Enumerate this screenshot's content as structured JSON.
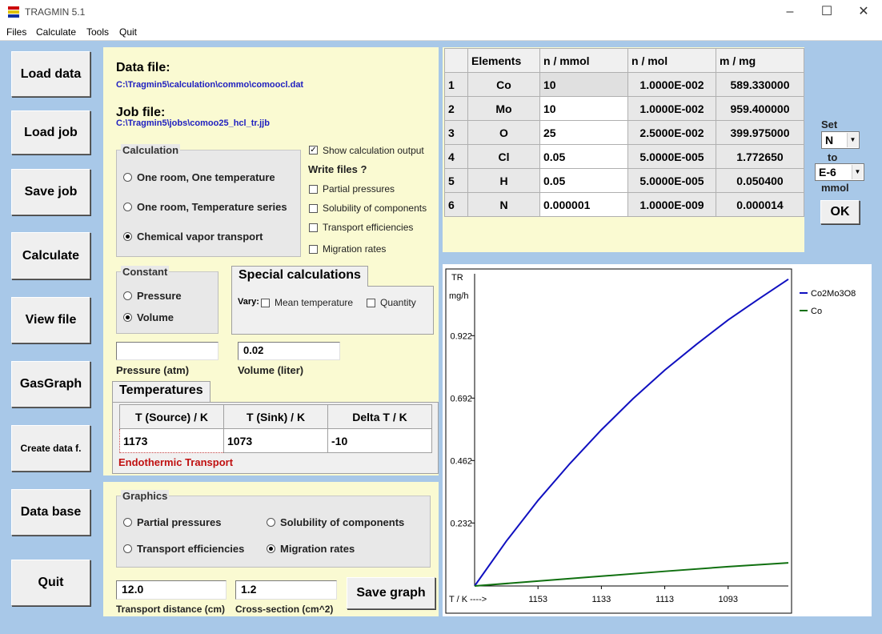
{
  "window": {
    "title": "TRAGMIN 5.1"
  },
  "menu": {
    "items": [
      "Files",
      "Calculate",
      "Tools",
      "Quit"
    ]
  },
  "sidebar": {
    "buttons": [
      "Load data",
      "Load job",
      "Save job",
      "Calculate",
      "View file",
      "GasGraph",
      "Create data f.",
      "Data base",
      "Quit"
    ]
  },
  "files": {
    "data_heading": "Data file:",
    "data_path": "C:\\Tragmin5\\calculation\\commo\\comoocl.dat",
    "job_heading": "Job file:",
    "job_path": "C:\\Tragmin5\\jobs\\comoo25_hcl_tr.jjb"
  },
  "calculation": {
    "label": "Calculation",
    "options": [
      "One room, One temperature",
      "One room, Temperature series",
      "Chemical vapor transport"
    ],
    "selected": 2
  },
  "output": {
    "show_label": "Show calculation output",
    "write_heading": "Write files ?",
    "checks": [
      "Partial pressures",
      "Solubility of components",
      "Transport efficiencies",
      "Migration rates"
    ]
  },
  "constant": {
    "label": "Constant",
    "options": [
      "Pressure",
      "Volume"
    ],
    "selected": 1
  },
  "special": {
    "tab": "Special calculations",
    "vary_label": "Vary:",
    "checks": [
      "Mean temperature",
      "Quantity"
    ]
  },
  "params": {
    "pressure_value": "",
    "pressure_label": "Pressure (atm)",
    "volume_value": "0.02",
    "volume_label": "Volume (liter)"
  },
  "temperatures": {
    "tab": "Temperatures",
    "headers": [
      "T (Source) / K",
      "T (Sink) / K",
      "Delta T / K"
    ],
    "values": [
      "1173",
      "1073",
      "-10"
    ],
    "note": "Endothermic Transport"
  },
  "graphics": {
    "label": "Graphics",
    "options": [
      "Partial pressures",
      "Solubility of components",
      "Transport efficiencies",
      "Migration rates"
    ],
    "selected": 3,
    "distance_value": "12.0",
    "distance_label": "Transport distance (cm)",
    "cross_value": "1.2",
    "cross_label": "Cross-section (cm^2)",
    "save_button": "Save graph"
  },
  "elements": {
    "headers": [
      "",
      "Elements",
      "n / mmol",
      "n / mol",
      "m / mg"
    ],
    "rows": [
      [
        "1",
        "Co",
        "10",
        "1.0000E-002",
        "589.330000"
      ],
      [
        "2",
        "Mo",
        "10",
        "1.0000E-002",
        "959.400000"
      ],
      [
        "3",
        "O",
        "25",
        "2.5000E-002",
        "399.975000"
      ],
      [
        "4",
        "Cl",
        "0.05",
        "5.0000E-005",
        "1.772650"
      ],
      [
        "5",
        "H",
        "0.05",
        "5.0000E-005",
        "0.050400"
      ],
      [
        "6",
        "N",
        "0.000001",
        "1.0000E-009",
        "0.000014"
      ]
    ]
  },
  "setbox": {
    "set_label": "Set",
    "set_value": "N",
    "to_label": "to",
    "to_value": "E-6",
    "unit_label": "mmol",
    "ok_button": "OK"
  },
  "chart_data": {
    "type": "line",
    "ylabel_top": "TR",
    "ylabel_unit": "mg/h",
    "xlabel": "T / K ---->",
    "x_ticks": [
      1153,
      1133,
      1113,
      1093
    ],
    "y_ticks": [
      0.232,
      0.462,
      0.692,
      0.922
    ],
    "xlim": [
      1173,
      1074
    ],
    "ylim": [
      0,
      1.15
    ],
    "series": [
      {
        "name": "Co2Mo3O8",
        "color": "#1010c0",
        "x": [
          1173,
          1163,
          1153,
          1143,
          1133,
          1123,
          1113,
          1103,
          1093,
          1083,
          1074
        ],
        "y": [
          0,
          0.165,
          0.315,
          0.45,
          0.575,
          0.69,
          0.795,
          0.89,
          0.98,
          1.06,
          1.13
        ]
      },
      {
        "name": "Co",
        "color": "#107010",
        "x": [
          1173,
          1153,
          1133,
          1113,
          1093,
          1074
        ],
        "y": [
          0,
          0.018,
          0.036,
          0.054,
          0.071,
          0.085
        ]
      }
    ]
  }
}
